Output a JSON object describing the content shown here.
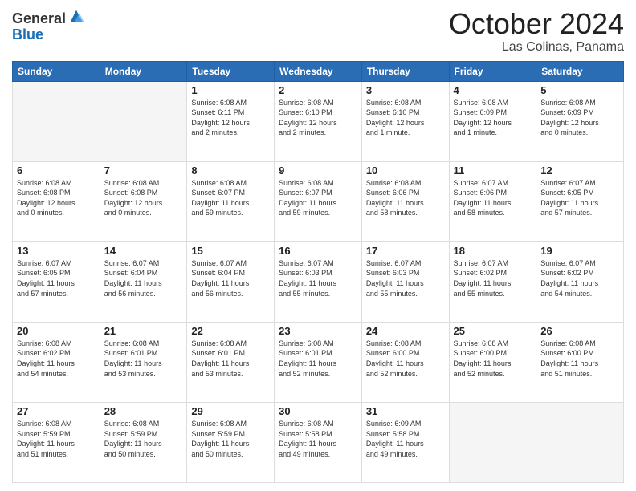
{
  "header": {
    "logo_line1": "General",
    "logo_line2": "Blue",
    "month": "October 2024",
    "location": "Las Colinas, Panama"
  },
  "weekdays": [
    "Sunday",
    "Monday",
    "Tuesday",
    "Wednesday",
    "Thursday",
    "Friday",
    "Saturday"
  ],
  "weeks": [
    [
      {
        "day": "",
        "info": ""
      },
      {
        "day": "",
        "info": ""
      },
      {
        "day": "1",
        "info": "Sunrise: 6:08 AM\nSunset: 6:11 PM\nDaylight: 12 hours\nand 2 minutes."
      },
      {
        "day": "2",
        "info": "Sunrise: 6:08 AM\nSunset: 6:10 PM\nDaylight: 12 hours\nand 2 minutes."
      },
      {
        "day": "3",
        "info": "Sunrise: 6:08 AM\nSunset: 6:10 PM\nDaylight: 12 hours\nand 1 minute."
      },
      {
        "day": "4",
        "info": "Sunrise: 6:08 AM\nSunset: 6:09 PM\nDaylight: 12 hours\nand 1 minute."
      },
      {
        "day": "5",
        "info": "Sunrise: 6:08 AM\nSunset: 6:09 PM\nDaylight: 12 hours\nand 0 minutes."
      }
    ],
    [
      {
        "day": "6",
        "info": "Sunrise: 6:08 AM\nSunset: 6:08 PM\nDaylight: 12 hours\nand 0 minutes."
      },
      {
        "day": "7",
        "info": "Sunrise: 6:08 AM\nSunset: 6:08 PM\nDaylight: 12 hours\nand 0 minutes."
      },
      {
        "day": "8",
        "info": "Sunrise: 6:08 AM\nSunset: 6:07 PM\nDaylight: 11 hours\nand 59 minutes."
      },
      {
        "day": "9",
        "info": "Sunrise: 6:08 AM\nSunset: 6:07 PM\nDaylight: 11 hours\nand 59 minutes."
      },
      {
        "day": "10",
        "info": "Sunrise: 6:08 AM\nSunset: 6:06 PM\nDaylight: 11 hours\nand 58 minutes."
      },
      {
        "day": "11",
        "info": "Sunrise: 6:07 AM\nSunset: 6:06 PM\nDaylight: 11 hours\nand 58 minutes."
      },
      {
        "day": "12",
        "info": "Sunrise: 6:07 AM\nSunset: 6:05 PM\nDaylight: 11 hours\nand 57 minutes."
      }
    ],
    [
      {
        "day": "13",
        "info": "Sunrise: 6:07 AM\nSunset: 6:05 PM\nDaylight: 11 hours\nand 57 minutes."
      },
      {
        "day": "14",
        "info": "Sunrise: 6:07 AM\nSunset: 6:04 PM\nDaylight: 11 hours\nand 56 minutes."
      },
      {
        "day": "15",
        "info": "Sunrise: 6:07 AM\nSunset: 6:04 PM\nDaylight: 11 hours\nand 56 minutes."
      },
      {
        "day": "16",
        "info": "Sunrise: 6:07 AM\nSunset: 6:03 PM\nDaylight: 11 hours\nand 55 minutes."
      },
      {
        "day": "17",
        "info": "Sunrise: 6:07 AM\nSunset: 6:03 PM\nDaylight: 11 hours\nand 55 minutes."
      },
      {
        "day": "18",
        "info": "Sunrise: 6:07 AM\nSunset: 6:02 PM\nDaylight: 11 hours\nand 55 minutes."
      },
      {
        "day": "19",
        "info": "Sunrise: 6:07 AM\nSunset: 6:02 PM\nDaylight: 11 hours\nand 54 minutes."
      }
    ],
    [
      {
        "day": "20",
        "info": "Sunrise: 6:08 AM\nSunset: 6:02 PM\nDaylight: 11 hours\nand 54 minutes."
      },
      {
        "day": "21",
        "info": "Sunrise: 6:08 AM\nSunset: 6:01 PM\nDaylight: 11 hours\nand 53 minutes."
      },
      {
        "day": "22",
        "info": "Sunrise: 6:08 AM\nSunset: 6:01 PM\nDaylight: 11 hours\nand 53 minutes."
      },
      {
        "day": "23",
        "info": "Sunrise: 6:08 AM\nSunset: 6:01 PM\nDaylight: 11 hours\nand 52 minutes."
      },
      {
        "day": "24",
        "info": "Sunrise: 6:08 AM\nSunset: 6:00 PM\nDaylight: 11 hours\nand 52 minutes."
      },
      {
        "day": "25",
        "info": "Sunrise: 6:08 AM\nSunset: 6:00 PM\nDaylight: 11 hours\nand 52 minutes."
      },
      {
        "day": "26",
        "info": "Sunrise: 6:08 AM\nSunset: 6:00 PM\nDaylight: 11 hours\nand 51 minutes."
      }
    ],
    [
      {
        "day": "27",
        "info": "Sunrise: 6:08 AM\nSunset: 5:59 PM\nDaylight: 11 hours\nand 51 minutes."
      },
      {
        "day": "28",
        "info": "Sunrise: 6:08 AM\nSunset: 5:59 PM\nDaylight: 11 hours\nand 50 minutes."
      },
      {
        "day": "29",
        "info": "Sunrise: 6:08 AM\nSunset: 5:59 PM\nDaylight: 11 hours\nand 50 minutes."
      },
      {
        "day": "30",
        "info": "Sunrise: 6:08 AM\nSunset: 5:58 PM\nDaylight: 11 hours\nand 49 minutes."
      },
      {
        "day": "31",
        "info": "Sunrise: 6:09 AM\nSunset: 5:58 PM\nDaylight: 11 hours\nand 49 minutes."
      },
      {
        "day": "",
        "info": ""
      },
      {
        "day": "",
        "info": ""
      }
    ]
  ]
}
